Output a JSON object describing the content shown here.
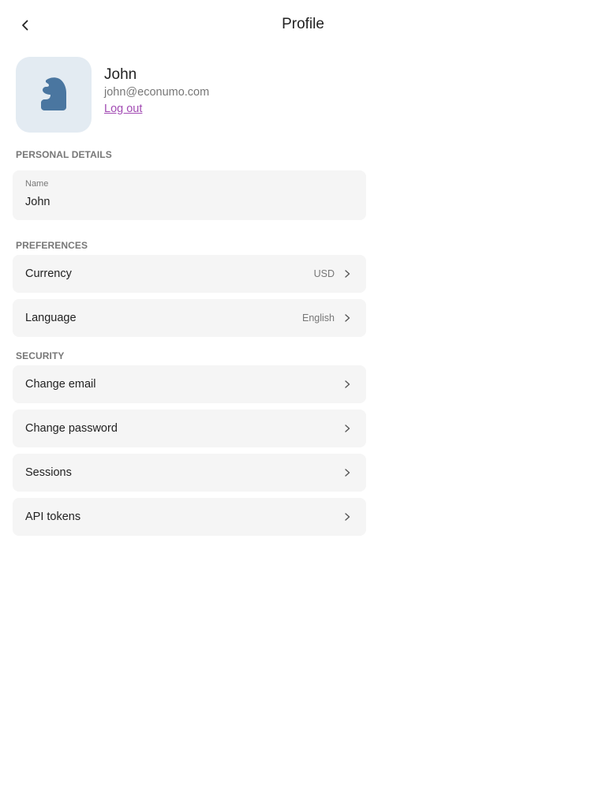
{
  "header": {
    "title": "Profile",
    "back_icon": "chevron-left-icon"
  },
  "profile": {
    "avatar_icon": "knight-chess-icon",
    "avatar_bg": "#e3ebf2",
    "avatar_fg": "#4a76a0",
    "name": "John",
    "email": "john@econumo.com",
    "logout_label": "Log out",
    "logout_color": "#a24bb3"
  },
  "personal_details": {
    "header": "PERSONAL DETAILS",
    "name_field": {
      "label": "Name",
      "value": "John"
    }
  },
  "preferences": {
    "header": "PREFERENCES",
    "items": [
      {
        "label": "Currency",
        "value": "USD"
      },
      {
        "label": "Language",
        "value": "English"
      }
    ]
  },
  "security": {
    "header": "SECURITY",
    "items": [
      {
        "label": "Change email"
      },
      {
        "label": "Change password"
      },
      {
        "label": "Sessions"
      },
      {
        "label": "API tokens"
      }
    ]
  }
}
